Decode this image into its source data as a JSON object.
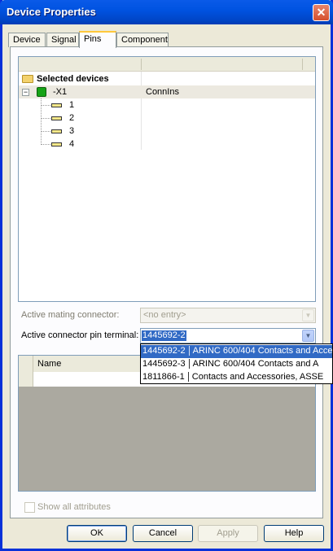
{
  "window": {
    "title": "Device Properties"
  },
  "tabs": [
    {
      "label": "Device"
    },
    {
      "label": "Signal"
    },
    {
      "label": "Pins"
    },
    {
      "label": "Component"
    }
  ],
  "tree": {
    "root_label": "Selected devices",
    "device": {
      "name": "-X1",
      "value": "ConnIns"
    },
    "pins": [
      "1",
      "2",
      "3",
      "4"
    ]
  },
  "fields": {
    "mating_connector_label": "Active mating connector:",
    "mating_connector_value": "<no entry>",
    "pin_terminal_label": "Active connector pin terminal:",
    "pin_terminal_value": "1445692-2"
  },
  "dropdown": {
    "options": [
      {
        "part": "1445692-2",
        "desc": "ARINC 600/404 Contacts and Acce"
      },
      {
        "part": "1445692-3",
        "desc": "ARINC 600/404 Contacts and A"
      },
      {
        "part": "1811866-1",
        "desc": "Contacts and Accessories, ASSE"
      }
    ]
  },
  "grid": {
    "column_name": "Name"
  },
  "checkbox": {
    "label": "Show all attributes"
  },
  "buttons": {
    "ok": "OK",
    "cancel": "Cancel",
    "apply": "Apply",
    "help": "Help"
  }
}
